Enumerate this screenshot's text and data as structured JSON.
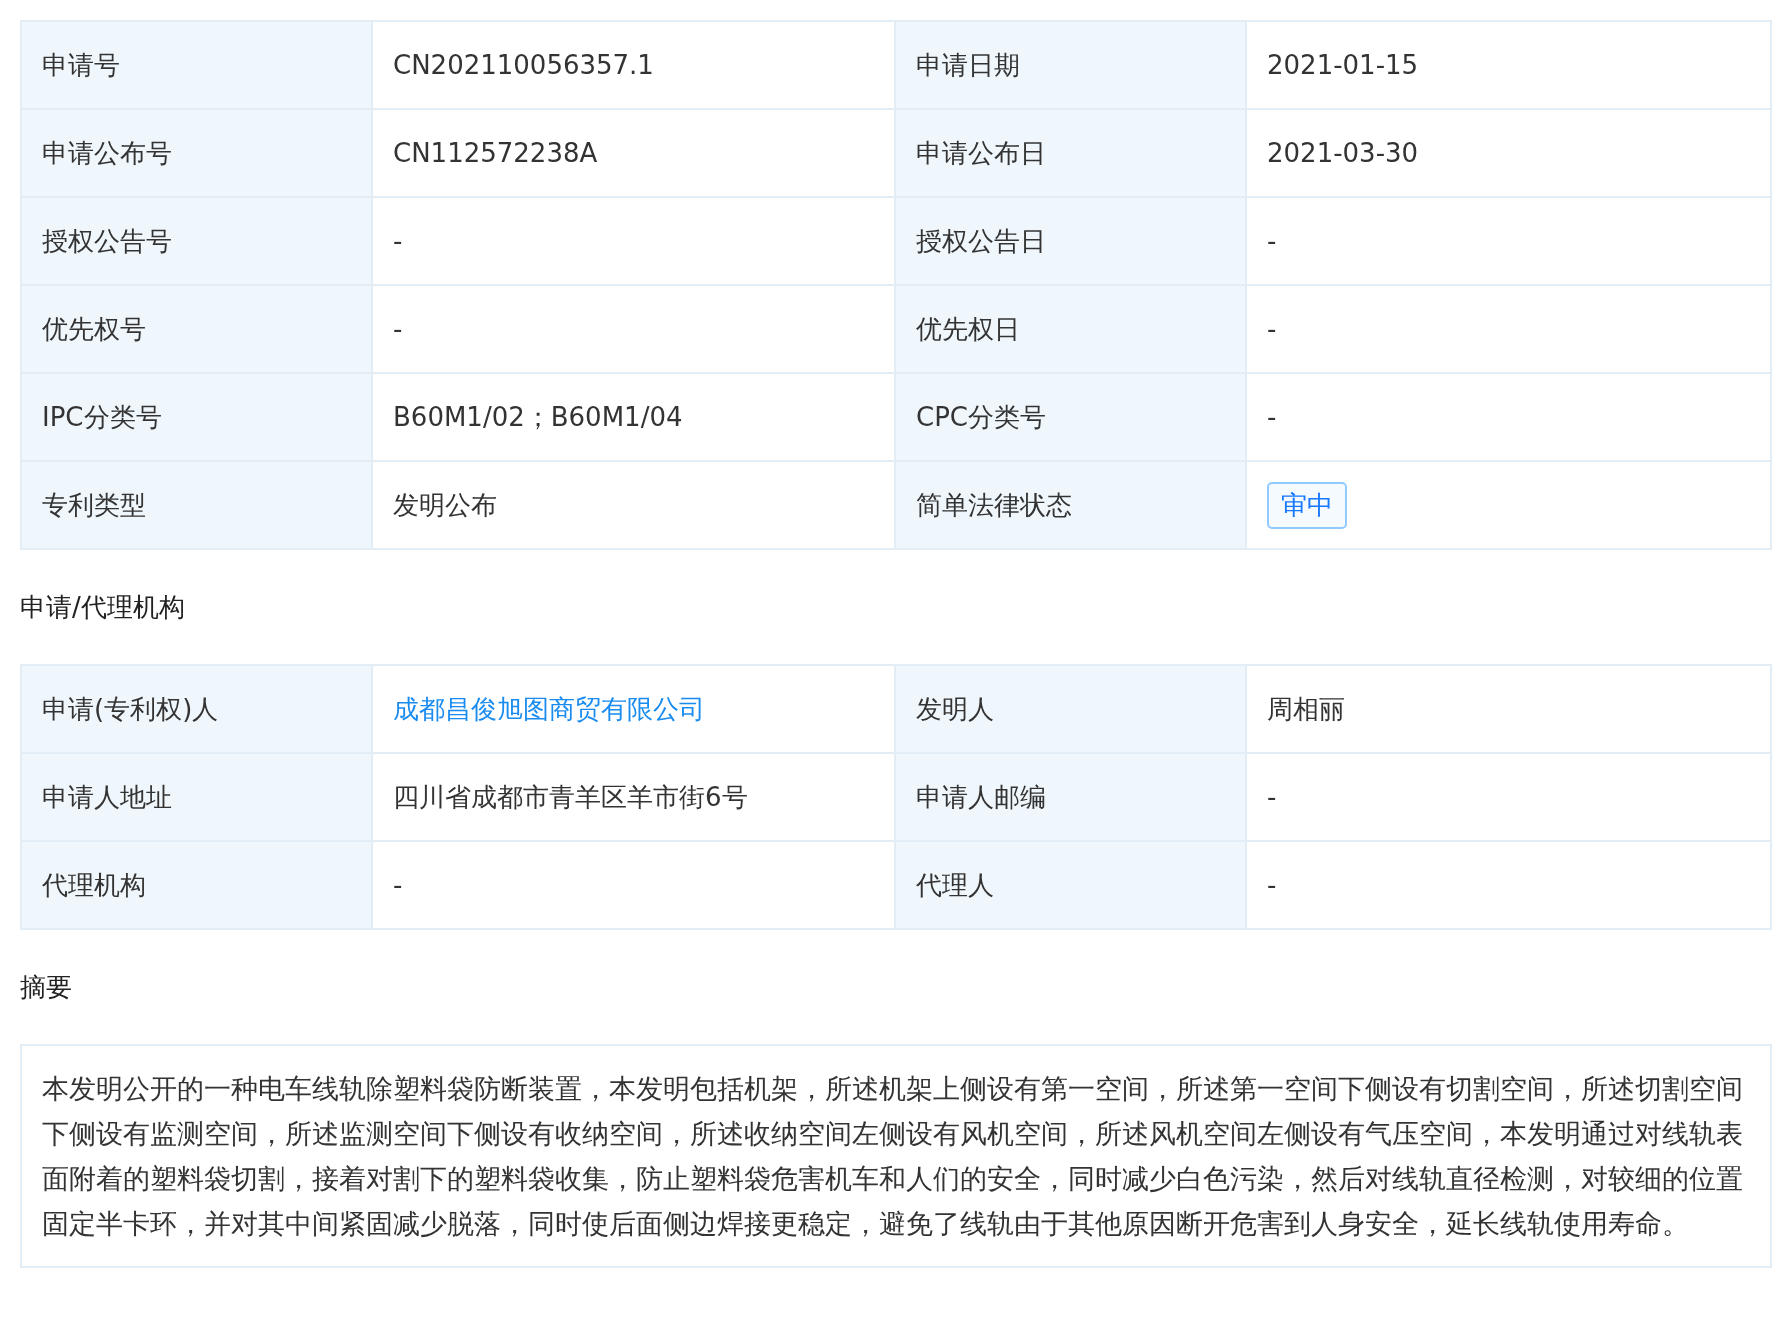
{
  "basic_table": {
    "rows": [
      {
        "cells": [
          {
            "label": "申请号",
            "kind": "text",
            "value": "CN202110056357.1"
          },
          {
            "label": "申请日期",
            "kind": "text",
            "value": "2021-01-15"
          }
        ]
      },
      {
        "cells": [
          {
            "label": "申请公布号",
            "kind": "text",
            "value": "CN112572238A"
          },
          {
            "label": "申请公布日",
            "kind": "text",
            "value": "2021-03-30"
          }
        ]
      },
      {
        "cells": [
          {
            "label": "授权公告号",
            "kind": "text",
            "value": "-"
          },
          {
            "label": "授权公告日",
            "kind": "text",
            "value": "-"
          }
        ]
      },
      {
        "cells": [
          {
            "label": "优先权号",
            "kind": "text",
            "value": "-"
          },
          {
            "label": "优先权日",
            "kind": "text",
            "value": "-"
          }
        ]
      },
      {
        "cells": [
          {
            "label": "IPC分类号",
            "kind": "text",
            "value": "B60M1/02；B60M1/04"
          },
          {
            "label": "CPC分类号",
            "kind": "text",
            "value": "-"
          }
        ]
      },
      {
        "cells": [
          {
            "label": "专利类型",
            "kind": "text",
            "value": "发明公布"
          },
          {
            "label": "简单法律状态",
            "kind": "tag",
            "value": "审中"
          }
        ]
      }
    ]
  },
  "agency_section": {
    "title": "申请/代理机构",
    "rows": [
      {
        "cells": [
          {
            "label": "申请(专利权)人",
            "kind": "link",
            "value": "成都昌俊旭图商贸有限公司"
          },
          {
            "label": "发明人",
            "kind": "text",
            "value": "周相丽"
          }
        ]
      },
      {
        "cells": [
          {
            "label": "申请人地址",
            "kind": "text",
            "value": "四川省成都市青羊区羊市街6号"
          },
          {
            "label": "申请人邮编",
            "kind": "text",
            "value": "-"
          }
        ]
      },
      {
        "cells": [
          {
            "label": "代理机构",
            "kind": "text",
            "value": "-"
          },
          {
            "label": "代理人",
            "kind": "text",
            "value": "-"
          }
        ]
      }
    ]
  },
  "abstract_section": {
    "title": "摘要",
    "text": "本发明公开的一种电车线轨除塑料袋防断装置，本发明包括机架，所述机架上侧设有第一空间，所述第一空间下侧设有切割空间，所述切割空间下侧设有监测空间，所述监测空间下侧设有收纳空间，所述收纳空间左侧设有风机空间，所述风机空间左侧设有气压空间，本发明通过对线轨表面附着的塑料袋切割，接着对割下的塑料袋收集，防止塑料袋危害机车和人们的安全，同时减少白色污染，然后对线轨直径检测，对较细的位置固定半卡环，并对其中间紧固减少脱落，同时使后面侧边焊接更稳定，避免了线轨由于其他原因断开危害到人身安全，延长线轨使用寿命。"
  }
}
